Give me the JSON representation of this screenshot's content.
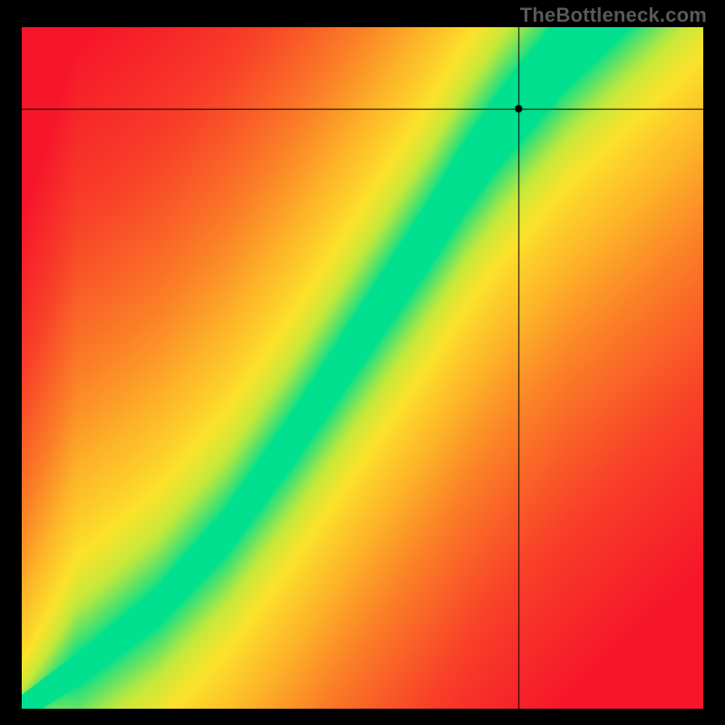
{
  "watermark": "TheBottleneck.com",
  "chart_data": {
    "type": "heatmap",
    "title": "",
    "xlabel": "",
    "ylabel": "",
    "xlim": [
      0,
      100
    ],
    "ylim": [
      0,
      100
    ],
    "crosshair": {
      "x": 73,
      "y": 88
    },
    "optimal_curve": [
      {
        "x": 0,
        "y": 0
      },
      {
        "x": 10,
        "y": 7
      },
      {
        "x": 20,
        "y": 15
      },
      {
        "x": 30,
        "y": 26
      },
      {
        "x": 40,
        "y": 40
      },
      {
        "x": 50,
        "y": 55
      },
      {
        "x": 60,
        "y": 70
      },
      {
        "x": 65,
        "y": 78
      },
      {
        "x": 70,
        "y": 85
      },
      {
        "x": 75,
        "y": 91
      },
      {
        "x": 80,
        "y": 97
      },
      {
        "x": 85,
        "y": 102
      },
      {
        "x": 90,
        "y": 107
      },
      {
        "x": 100,
        "y": 117
      }
    ],
    "band_halfwidth_base": 2.0,
    "band_halfwidth_scale": 0.05,
    "gradient_stops": [
      {
        "t": 0.0,
        "color": "#00e08e"
      },
      {
        "t": 0.1,
        "color": "#54e26a"
      },
      {
        "t": 0.2,
        "color": "#c6e93a"
      },
      {
        "t": 0.3,
        "color": "#fce22b"
      },
      {
        "t": 0.45,
        "color": "#fdb528"
      },
      {
        "t": 0.6,
        "color": "#fb7f27"
      },
      {
        "t": 0.8,
        "color": "#f84028"
      },
      {
        "t": 1.0,
        "color": "#f6162a"
      }
    ]
  }
}
